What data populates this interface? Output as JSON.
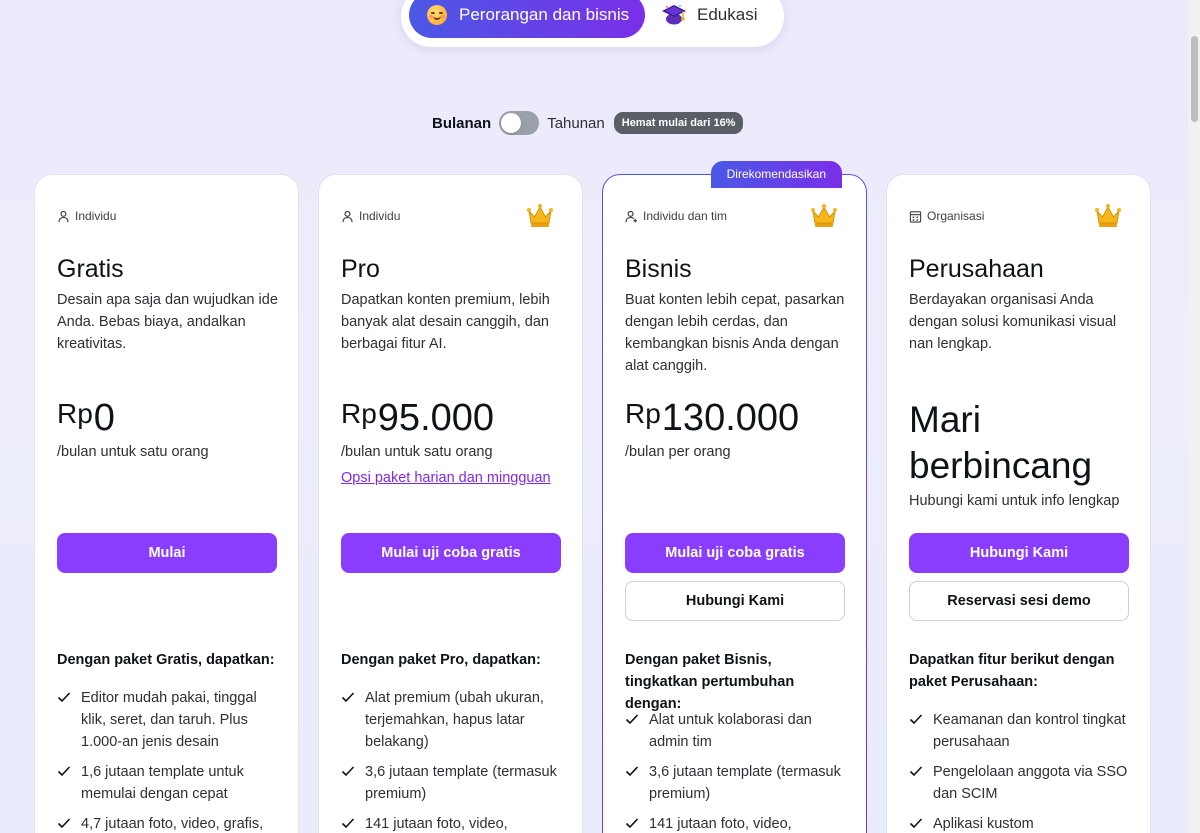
{
  "tabs": {
    "personal": "Perorangan dan bisnis",
    "education": "Edukasi"
  },
  "billing": {
    "monthly": "Bulanan",
    "yearly": "Tahunan",
    "savings_badge": "Hemat mulai dari 16%",
    "yearly_selected": false
  },
  "colors": {
    "accent": "#8b3dff",
    "gradient_start": "#4b58e6",
    "gradient_end": "#7a2fe8",
    "crown": "#f6b519"
  },
  "plans": [
    {
      "audience": "Individu",
      "audience_icon": "person-icon",
      "has_crown": false,
      "name": "Gratis",
      "description": "Desain apa saja dan wujudkan ide Anda. Bebas biaya, andalkan kreativitas.",
      "currency": "Rp",
      "price": "0",
      "period": "/bulan untuk satu orang",
      "primary_button": "Mulai",
      "features_title": "Dengan paket Gratis, dapatkan:",
      "features": [
        "Editor mudah pakai, tinggal klik, seret, dan taruh. Plus 1.000-an jenis desain",
        "1,6 jutaan template untuk memulai dengan cepat",
        "4,7 jutaan foto, video, grafis,"
      ]
    },
    {
      "audience": "Individu",
      "audience_icon": "person-icon",
      "has_crown": true,
      "name": "Pro",
      "description": "Dapatkan konten premium, lebih banyak alat desain canggih, dan berbagai fitur AI.",
      "currency": "Rp",
      "price": "95.000",
      "period": "/bulan untuk satu orang",
      "options_link": "Opsi paket harian dan mingguan",
      "primary_button": "Mulai uji coba gratis",
      "features_title": "Dengan paket Pro, dapatkan:",
      "features": [
        "Alat premium (ubah ukuran, terjemahkan, hapus latar belakang)",
        "3,6 jutaan template (termasuk premium)",
        "141 jutaan foto, video,"
      ]
    },
    {
      "audience": "Individu dan tim",
      "audience_icon": "person-plus-icon",
      "has_crown": true,
      "recommended": "Direkomendasikan",
      "name": "Bisnis",
      "description": "Buat konten lebih cepat, pasarkan dengan lebih cerdas, dan kembangkan bisnis Anda dengan alat canggih.",
      "currency": "Rp",
      "price": "130.000",
      "period": "/bulan per orang",
      "primary_button": "Mulai uji coba gratis",
      "secondary_button": "Hubungi Kami",
      "features_title": "Dengan paket Bisnis, tingkatkan pertumbuhan dengan:",
      "features": [
        "Alat untuk kolaborasi dan admin tim",
        "3,6 jutaan template (termasuk premium)",
        "141 jutaan foto, video,"
      ]
    },
    {
      "audience": "Organisasi",
      "audience_icon": "building-icon",
      "has_crown": true,
      "name": "Perusahaan",
      "description": "Berdayakan organisasi Anda dengan solusi komunikasi visual nan lengkap.",
      "headline": "Mari berbincang",
      "headline_sub": "Hubungi kami untuk info lengkap",
      "primary_button": "Hubungi Kami",
      "secondary_button": "Reservasi sesi demo",
      "features_title": "Dapatkan fitur berikut dengan paket Perusahaan:",
      "features": [
        "Keamanan dan kontrol tingkat perusahaan",
        "Pengelolaan anggota via SSO dan SCIM",
        "Aplikasi kustom"
      ]
    }
  ]
}
